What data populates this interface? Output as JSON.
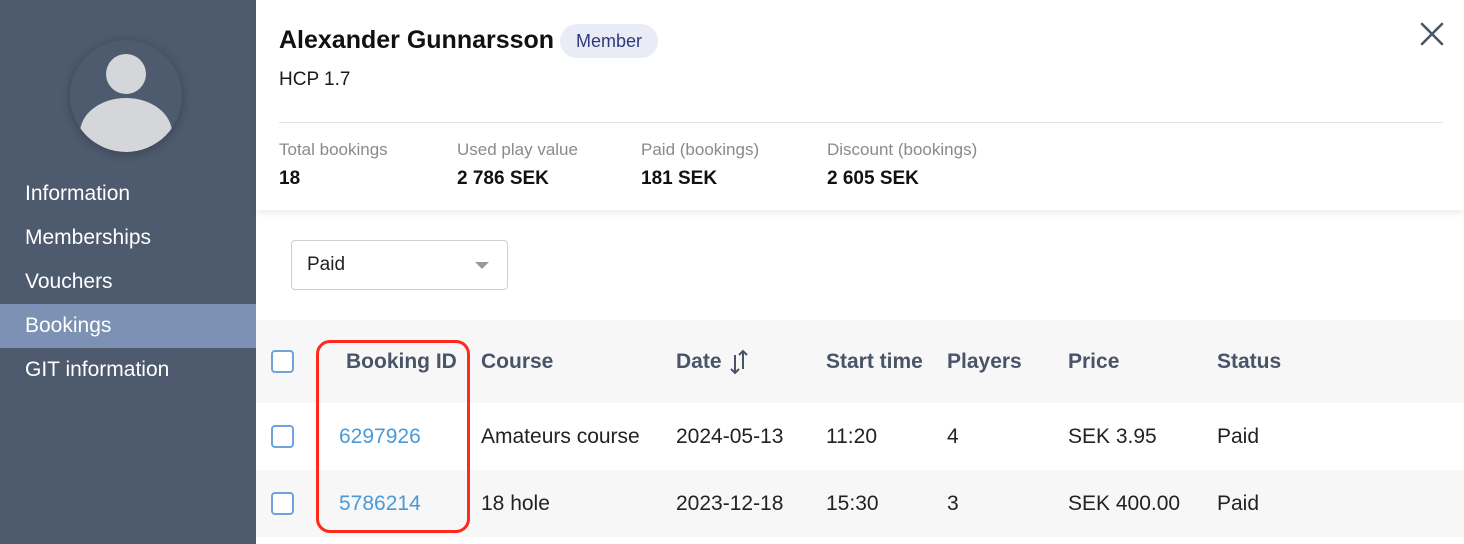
{
  "sidebar": {
    "items": [
      {
        "label": "Information",
        "active": false
      },
      {
        "label": "Memberships",
        "active": false
      },
      {
        "label": "Vouchers",
        "active": false
      },
      {
        "label": "Bookings",
        "active": true
      },
      {
        "label": "GIT information",
        "active": false
      }
    ]
  },
  "profile": {
    "name": "Alexander Gunnarsson",
    "badge": "Member",
    "hcp": "HCP 1.7"
  },
  "stats": [
    {
      "label": "Total bookings",
      "value": "18"
    },
    {
      "label": "Used play value",
      "value": "2 786 SEK"
    },
    {
      "label": "Paid (bookings)",
      "value": "181 SEK"
    },
    {
      "label": "Discount (bookings)",
      "value": "2 605 SEK"
    }
  ],
  "filter": {
    "selected": "Paid"
  },
  "table": {
    "columns": [
      "Booking ID",
      "Course",
      "Date",
      "Start time",
      "Players",
      "Price",
      "Status"
    ],
    "rows": [
      [
        "6297926",
        "Amateurs course",
        "2024-05-13",
        "11:20",
        "4",
        "SEK 3.95",
        "Paid"
      ],
      [
        "5786214",
        "18 hole",
        "2023-12-18",
        "15:30",
        "3",
        "SEK 400.00",
        "Paid"
      ]
    ]
  },
  "colors": {
    "sidebar": "#4e5a6e",
    "sidebar_active": "#7c91b3",
    "link": "#4a9ad8",
    "highlight": "#ff2a1a"
  }
}
